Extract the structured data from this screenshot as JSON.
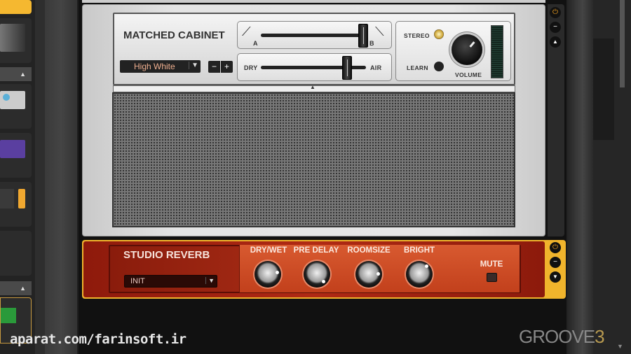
{
  "cabinet": {
    "title": "MATCHED CABINET",
    "preset": "High White",
    "minus": "−",
    "plus": "+",
    "mic_slider": {
      "label_a": "A",
      "label_b": "B",
      "value": 1.0
    },
    "air_slider": {
      "label_dry": "DRY",
      "label_air": "AIR",
      "value": 0.8
    },
    "stereo_label": "STEREO",
    "stereo_on": true,
    "learn_label": "LEARN",
    "volume_label": "VOLUME"
  },
  "reverb": {
    "title": "STUDIO REVERB",
    "preset": "INIT",
    "knobs": [
      {
        "label": "DRY/WET"
      },
      {
        "label": "PRE DELAY"
      },
      {
        "label": "ROOMSIZE"
      },
      {
        "label": "BRIGHT"
      }
    ],
    "mute_label": "MUTE"
  },
  "watermarks": {
    "left": "aparat.com/farinsoft.ir",
    "brand": "GROOVE",
    "brand_num": "3"
  },
  "colors": {
    "accent": "#f0b42c",
    "reverb_red": "#a82a14",
    "power": "#f0a020"
  }
}
